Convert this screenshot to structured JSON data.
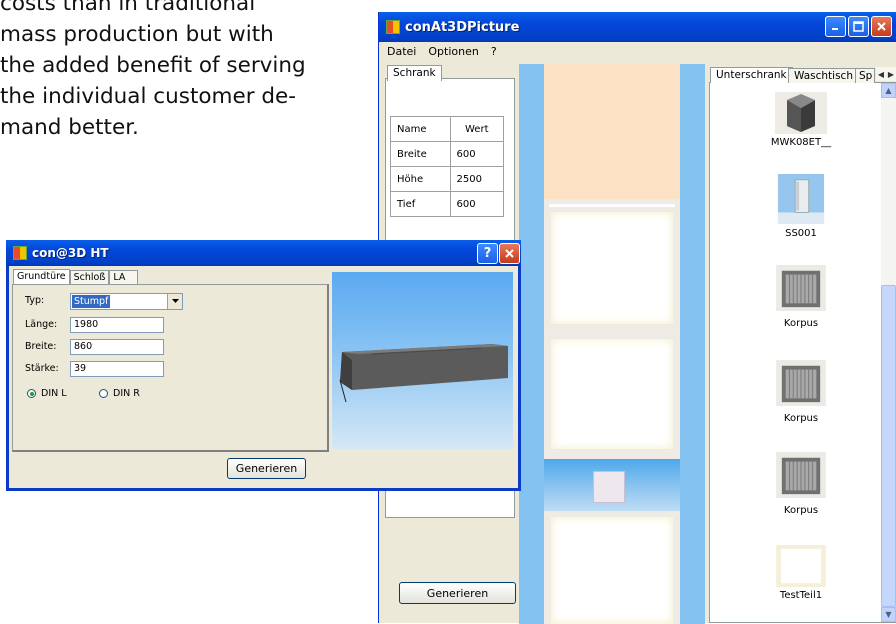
{
  "document": {
    "lines": [
      "costs than in traditional",
      "mass production but with",
      "the added benefit of serving",
      "the individual customer de-",
      "mand better."
    ]
  },
  "main_window": {
    "title": "conAt3DPicture",
    "menu": [
      "Datei",
      "Optionen",
      "?"
    ],
    "left_tab": "Schrank",
    "grid": {
      "headers": [
        "Name",
        "Wert"
      ],
      "rows": [
        {
          "name": "Breite",
          "value": "600"
        },
        {
          "name": "Höhe",
          "value": "2500"
        },
        {
          "name": "Tief",
          "value": "600"
        }
      ]
    },
    "generate_label": "Generieren",
    "right_tabs": [
      "Unterschrank",
      "Waschtisch",
      "Sp"
    ],
    "thumbnails": [
      "MWK08ET__",
      "SS001",
      "Korpus",
      "Korpus",
      "Korpus",
      "TestTeil1"
    ]
  },
  "dialog": {
    "title": "con@3D HT",
    "tabs": [
      "Grundtüre",
      "Schloß",
      "LA"
    ],
    "fields": [
      {
        "label": "Typ:",
        "value": "Stumpf"
      },
      {
        "label": "Länge:",
        "value": "1980"
      },
      {
        "label": "Breite:",
        "value": "860"
      },
      {
        "label": "Stärke:",
        "value": "39"
      }
    ],
    "radios": [
      {
        "label": "DIN L",
        "checked": true
      },
      {
        "label": "DIN R",
        "checked": false
      }
    ],
    "generate_label": "Generieren"
  },
  "colors": {
    "xp_blue": "#0346D9",
    "panel_bg": "#ECE9D8",
    "strip_blue": "#84C3F1",
    "peach": "#FCE1C5"
  }
}
